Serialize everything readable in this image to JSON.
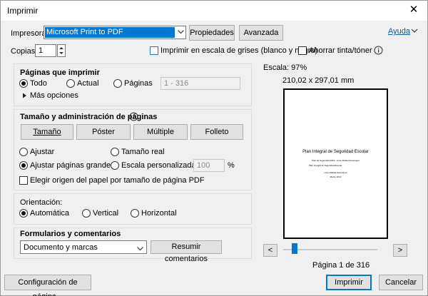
{
  "window": {
    "title": "Imprimir",
    "close_glyph": "✕"
  },
  "printer": {
    "label": "Impresora:",
    "selected": "Microsoft Print to PDF",
    "properties_label": "Propiedades",
    "advanced_label": "Avanzada",
    "help_label": "Ayuda",
    "copies_label": "Copias:",
    "copies_value": "1",
    "grayscale_label": "Imprimir en escala de grises (blanco y negro)",
    "save_ink_label": "Ahorrar tinta/tóner"
  },
  "pages_to_print": {
    "heading": "Páginas que imprimir",
    "all_label": "Todo",
    "current_label": "Actual",
    "pages_label": "Páginas",
    "pages_range": "1 - 316",
    "more_options_label": "Más opciones"
  },
  "page_sizing": {
    "heading": "Tamaño y administración de páginas",
    "tabs": [
      "Tamaño",
      "Póster",
      "Múltiple",
      "Folleto"
    ],
    "fit_label": "Ajustar",
    "actual_size_label": "Tamaño real",
    "shrink_label": "Ajustar páginas grandes",
    "custom_scale_label": "Escala personalizada:",
    "custom_scale_value": "100",
    "percent": "%",
    "choose_source_label": "Elegir origen del papel por tamaño de página PDF"
  },
  "orientation": {
    "heading": "Orientación:",
    "auto_label": "Automática",
    "portrait_label": "Vertical",
    "landscape_label": "Horizontal"
  },
  "forms": {
    "heading": "Formularios y comentarios",
    "selected": "Documento y marcas",
    "summarize_label": "Resumir comentarios"
  },
  "preview": {
    "scale_text": "Escala:  97%",
    "dimensions": "210,02 x 297,01 mm",
    "doc_title": "Plan Integral de Seguridad Escolar",
    "doc_line1": "Plan de Seguridad 2019 - Liceo Rafael Sotomayor",
    "doc_line2": "Plan Integral de Seguridad Escolar",
    "doc_line3": "Liceo Rafael Sotomayor",
    "doc_line4": "Marzo 2019",
    "page_indicator": "Página 1 de 316",
    "prev_glyph": "<",
    "next_glyph": ">"
  },
  "footer": {
    "page_setup_label": "Configuración de página...",
    "print_label": "Imprimir",
    "cancel_label": "Cancelar"
  },
  "icons": {
    "info": "info-icon",
    "dropdown": "chevron-down-icon",
    "close": "close-icon"
  }
}
